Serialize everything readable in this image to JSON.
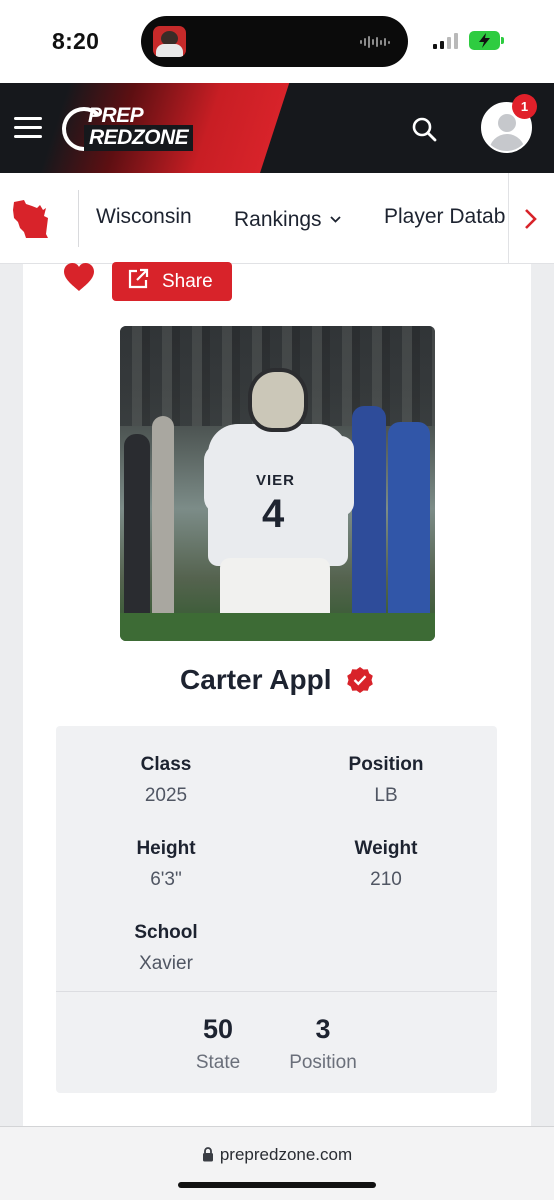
{
  "status_bar": {
    "time": "8:20",
    "battery_color": "#2ecc40"
  },
  "header": {
    "logo_line1": "PREP",
    "logo_line2": "REDZONE",
    "notification_count": "1",
    "brand_red": "#d8232a",
    "bg_color": "#16181c"
  },
  "subnav": {
    "state_icon": "wisconsin-state-icon",
    "items": [
      {
        "label": "Wisconsin"
      },
      {
        "label": "Rankings"
      },
      {
        "label": "Player Datab"
      }
    ]
  },
  "profile": {
    "share_label": "Share",
    "player_name": "Carter Appl",
    "photo_jersey_text": "VIER",
    "photo_jersey_number": "4",
    "details": [
      {
        "label": "Class",
        "value": "2025"
      },
      {
        "label": "Position",
        "value": "LB"
      },
      {
        "label": "Height",
        "value": "6'3\""
      },
      {
        "label": "Weight",
        "value": "210"
      },
      {
        "label": "School",
        "value": "Xavier"
      }
    ],
    "rankings": [
      {
        "number": "50",
        "label": "State"
      },
      {
        "number": "3",
        "label": "Position"
      }
    ]
  },
  "browser": {
    "url": "prepredzone.com"
  }
}
